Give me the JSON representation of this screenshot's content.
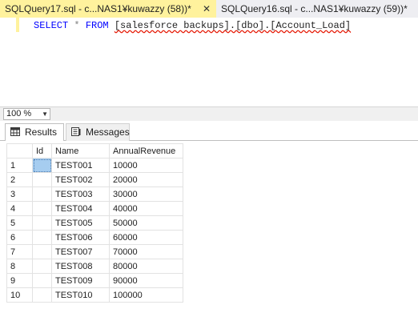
{
  "tabs": [
    {
      "label": "SQLQuery17.sql - c...NAS1¥kuwazzy (58))*",
      "close": "✕"
    },
    {
      "label": "SQLQuery16.sql - c...NAS1¥kuwazzy (59))*"
    }
  ],
  "editor": {
    "select_kw": "SELECT",
    "star": "*",
    "from_kw": "FROM",
    "table_ref": "[salesforce backups].[dbo].[Account_Load]"
  },
  "zoom": {
    "value": "100 %"
  },
  "results_tabs": {
    "results": "Results",
    "messages": "Messages"
  },
  "grid": {
    "columns": [
      "Id",
      "Name",
      "AnnualRevenue"
    ],
    "rows": [
      {
        "num": "1",
        "id": "",
        "name": "TEST001",
        "revenue": "10000"
      },
      {
        "num": "2",
        "id": "",
        "name": "TEST002",
        "revenue": "20000"
      },
      {
        "num": "3",
        "id": "",
        "name": "TEST003",
        "revenue": "30000"
      },
      {
        "num": "4",
        "id": "",
        "name": "TEST004",
        "revenue": "40000"
      },
      {
        "num": "5",
        "id": "",
        "name": "TEST005",
        "revenue": "50000"
      },
      {
        "num": "6",
        "id": "",
        "name": "TEST006",
        "revenue": "60000"
      },
      {
        "num": "7",
        "id": "",
        "name": "TEST007",
        "revenue": "70000"
      },
      {
        "num": "8",
        "id": "",
        "name": "TEST008",
        "revenue": "80000"
      },
      {
        "num": "9",
        "id": "",
        "name": "TEST009",
        "revenue": "90000"
      },
      {
        "num": "10",
        "id": "",
        "name": "TEST010",
        "revenue": "100000"
      }
    ]
  },
  "colors": {
    "active_tab": "#fff29d",
    "keyword": "#0000ff",
    "selection": "#a6cdf0"
  }
}
